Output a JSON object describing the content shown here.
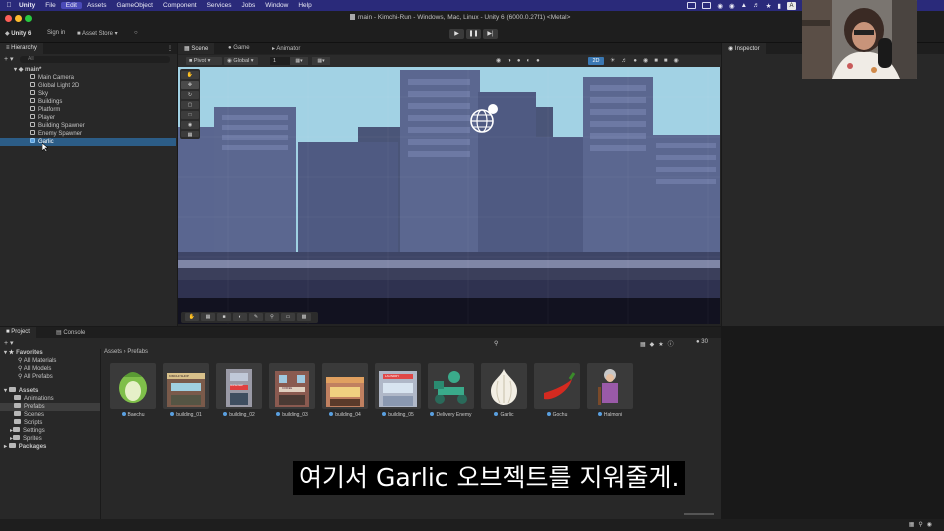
{
  "menubar": {
    "app": "Unity",
    "items": [
      "File",
      "Edit",
      "Assets",
      "GameObject",
      "Component",
      "Services",
      "Jobs",
      "Window",
      "Help"
    ],
    "active_item": "Edit",
    "tray_button": "A"
  },
  "window": {
    "title": "main - Kimchi-Run - Windows, Mac, Linux - Unity 6 (6000.0.27f1) <Metal>"
  },
  "toolbar": {
    "account": "Unity 6",
    "sign_in": "Sign in",
    "asset_store": "Asset Store"
  },
  "hierarchy": {
    "tab": "Hierarchy",
    "search_placeholder": "All",
    "scene_name": "main*",
    "items": [
      "Main Camera",
      "Global Light 2D",
      "Sky",
      "Buildings",
      "Platform",
      "Player",
      "Building Spawner",
      "Enemy Spawner",
      "Garlic"
    ],
    "selected_index": 8
  },
  "scene_view": {
    "tabs": [
      "Scene",
      "Game",
      "Animator"
    ],
    "pivot": "Pivot",
    "global": "Global",
    "snap_value": "1",
    "mode_2d": "2D"
  },
  "inspector": {
    "tab": "Inspector"
  },
  "project": {
    "tabs": [
      "Project",
      "Console"
    ],
    "breadcrumb": [
      "Assets",
      "Prefabs"
    ],
    "badge_count": "30",
    "favorites": {
      "label": "Favorites",
      "items": [
        "All Materials",
        "All Models",
        "All Prefabs"
      ]
    },
    "assets_root": "Assets",
    "folders": [
      "Animations",
      "Prefabs",
      "Scenes",
      "Scripts",
      "Settings",
      "Sprites"
    ],
    "selected_folder": "Prefabs",
    "packages": "Packages",
    "prefabs": [
      "Baechu",
      "building_01",
      "building_02",
      "building_03",
      "building_04",
      "building_05",
      "Delivery Enemy",
      "Garlic",
      "Gochu",
      "Halmoni"
    ],
    "thumb_signs": {
      "building_01": "KIMCHI SHOP",
      "building_02": "RESTAURANT",
      "building_03": "COFFEE",
      "building_05": "LAUNDRY"
    }
  },
  "subtitle": "여기서 Garlic 오브젝트를 지워줄게.",
  "colors": {
    "menubar": "#2a2a7a",
    "selection": "#2c5d87",
    "panel": "#282828",
    "sky": "#9fd1e3"
  }
}
